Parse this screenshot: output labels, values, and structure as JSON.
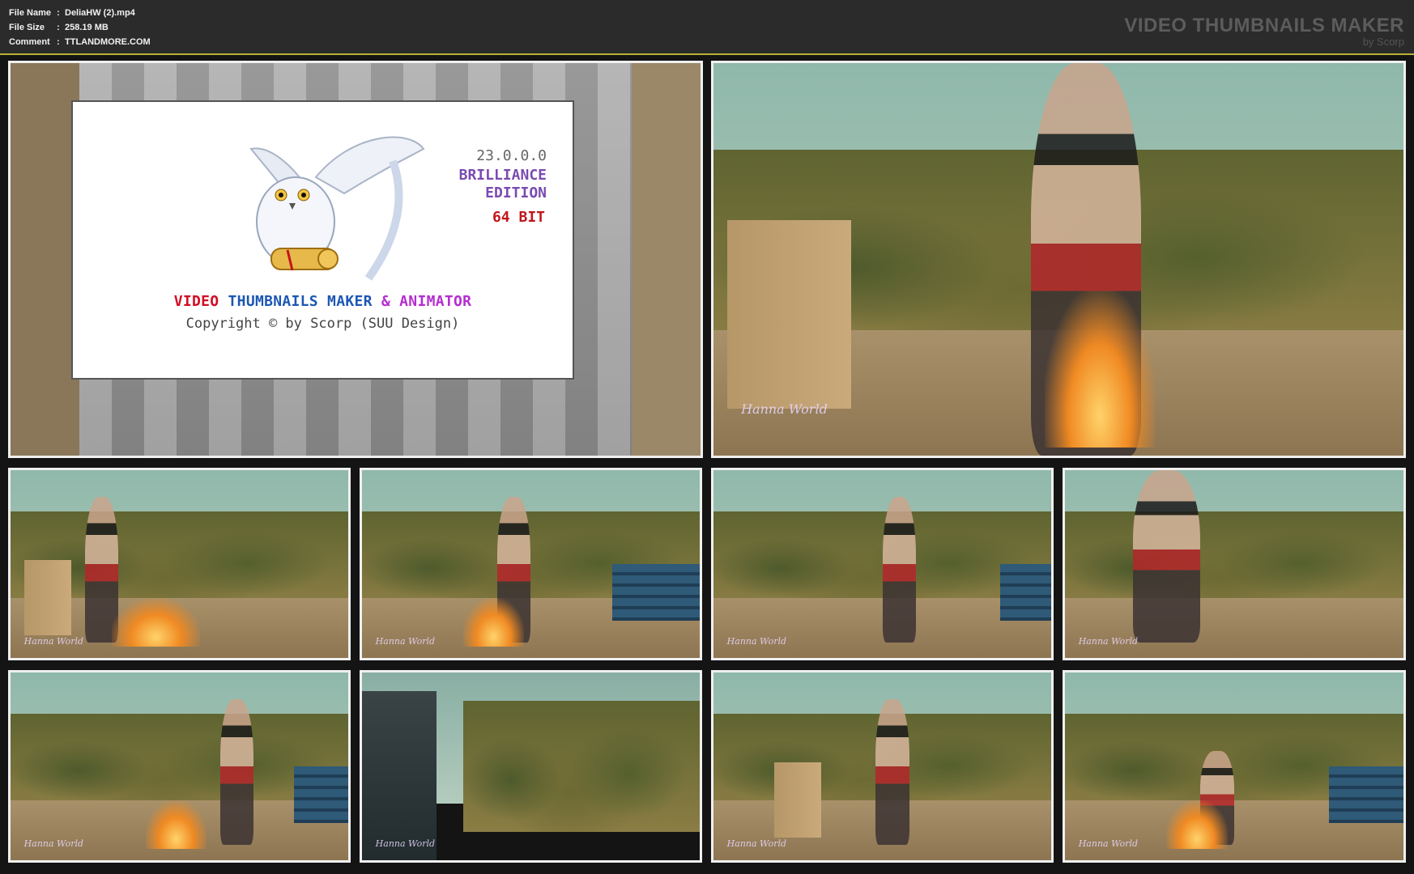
{
  "header": {
    "file_name_label": "File Name",
    "file_name_value": "DeliaHW (2).mp4",
    "file_size_label": "File Size",
    "file_size_value": "258.19 MB",
    "comment_label": "Comment",
    "comment_value": "TTLANDMORE.COM",
    "separator": ":",
    "brand_title": "VIDEO THUMBNAILS MAKER",
    "brand_sub": "by Scorp"
  },
  "splash": {
    "version": "23.0.0.0",
    "edition_line1": "BRILLIANCE",
    "edition_line2": "EDITION",
    "bitness": "64 BIT",
    "title_part1": "VIDEO",
    "title_part2": "THUMBNAILS MAKER",
    "title_part3": "& ANIMATOR",
    "copyright": "Copyright © by Scorp (SUU Design)"
  },
  "watermark": "Hanna World",
  "colors": {
    "header_bg": "#2b2b2b",
    "accent_line": "#b8b233",
    "tile_border": "#efefef"
  }
}
